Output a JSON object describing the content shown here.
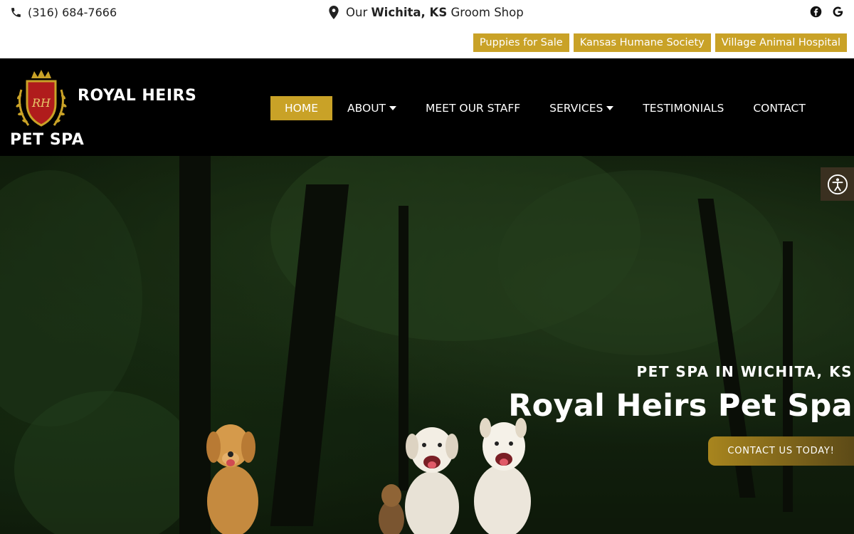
{
  "topbar": {
    "phone": "(316) 684-7666",
    "location_prefix": "Our",
    "location_bold": "Wichita, KS",
    "location_suffix": "Groom Shop",
    "social": [
      "facebook-icon",
      "google-icon"
    ],
    "quicklinks": [
      "Puppies for Sale",
      "Kansas Humane Society",
      "Village Animal Hospital"
    ]
  },
  "header": {
    "brand_line1": "ROYAL HEIRS",
    "brand_line2": "PET SPA",
    "crest_monogram": "RH",
    "nav": [
      {
        "label": "HOME",
        "active": true
      },
      {
        "label": "ABOUT",
        "dropdown": true
      },
      {
        "label": "MEET OUR STAFF"
      },
      {
        "label": "SERVICES",
        "dropdown": true
      },
      {
        "label": "TESTIMONIALS"
      },
      {
        "label": "CONTACT"
      }
    ]
  },
  "hero": {
    "eyebrow": "PET SPA IN WICHITA, KS",
    "title": "Royal Heirs Pet Spa",
    "cta": "CONTACT US TODAY!"
  },
  "colors": {
    "gold": "#c9a227",
    "black": "#000000",
    "white": "#ffffff"
  }
}
